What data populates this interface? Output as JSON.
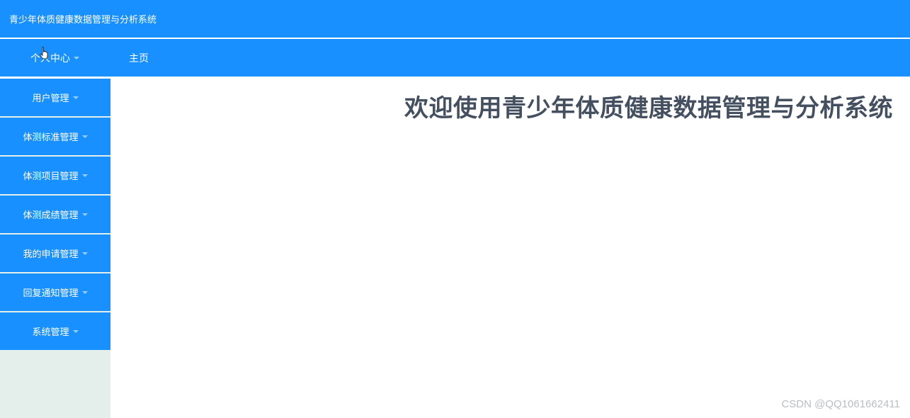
{
  "header": {
    "app_title": "青少年体质健康数据管理与分析系统"
  },
  "topnav": {
    "personal_center": "个人中心",
    "home": "主页"
  },
  "sidebar": {
    "items": [
      {
        "label": "用户管理"
      },
      {
        "label": "体测标准管理"
      },
      {
        "label": "体测项目管理"
      },
      {
        "label": "体测成绩管理"
      },
      {
        "label": "我的申请管理"
      },
      {
        "label": "回复通知管理"
      },
      {
        "label": "系统管理"
      }
    ]
  },
  "main": {
    "welcome_title": "欢迎使用青少年体质健康数据管理与分析系统"
  },
  "watermark": {
    "text": "CSDN @QQ1061662411"
  },
  "colors": {
    "primary": "#1890ff",
    "sidebar_bg": "#e4eeea",
    "welcome_text": "#44505f"
  }
}
